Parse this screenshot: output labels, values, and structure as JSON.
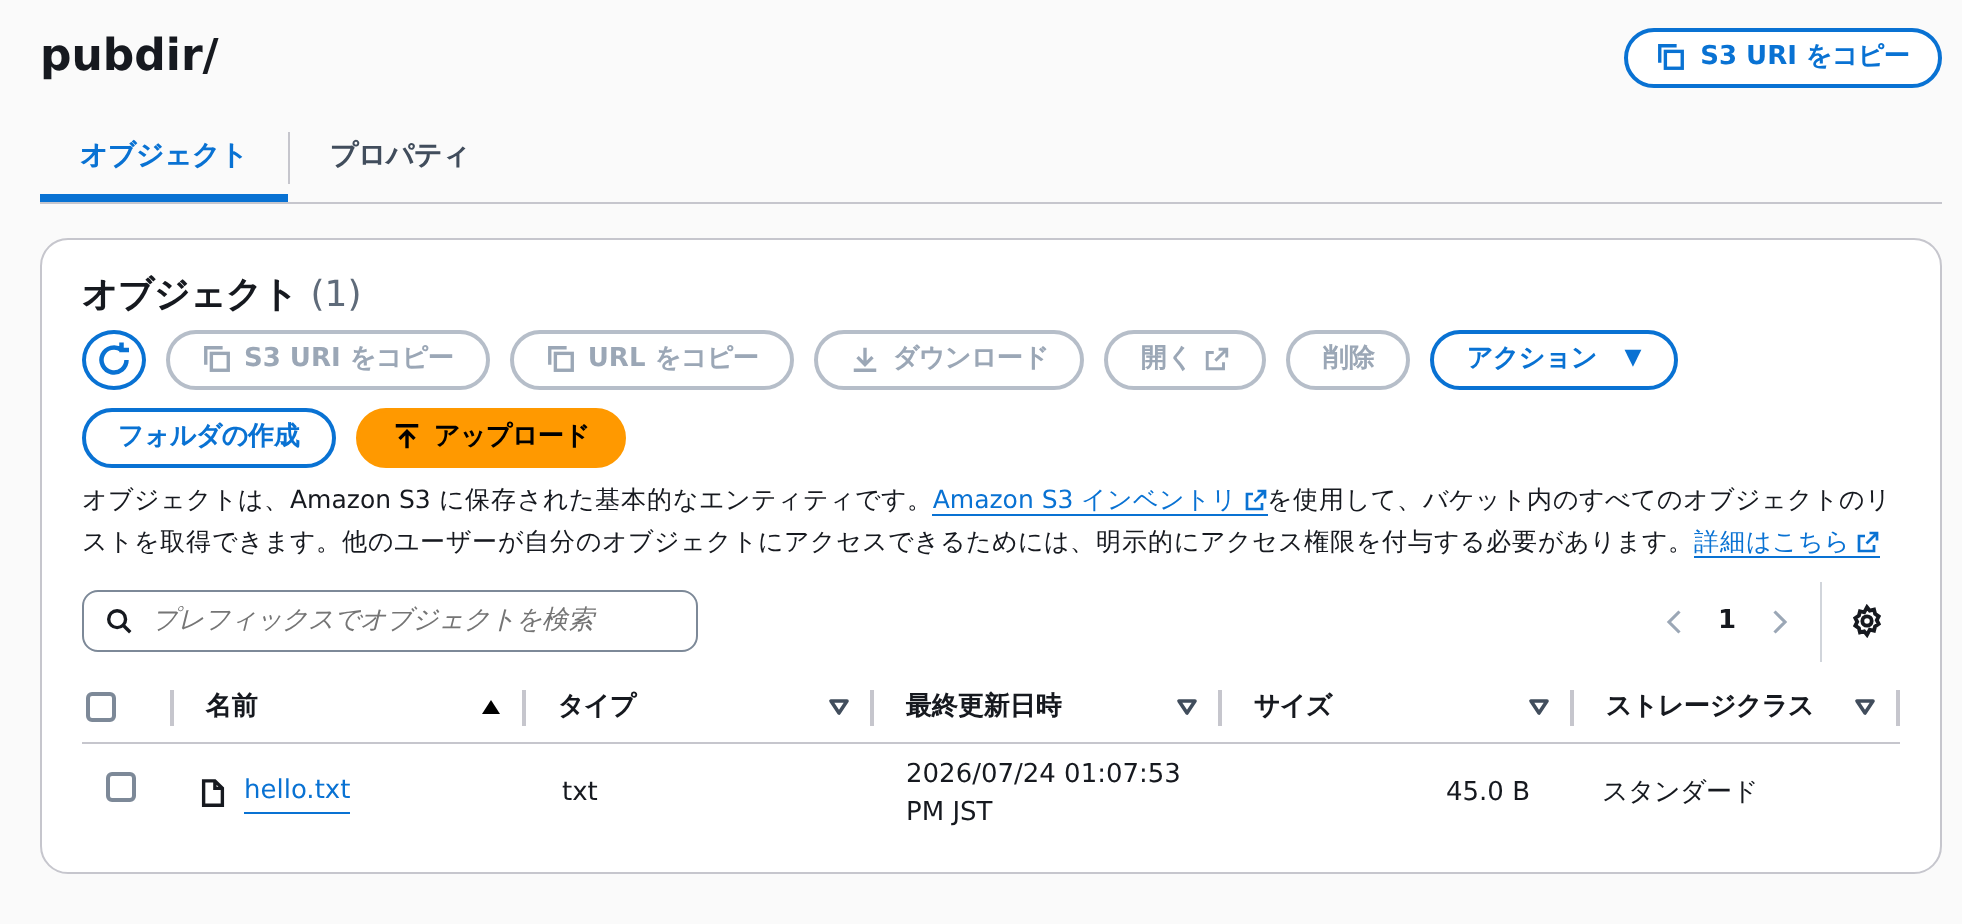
{
  "header": {
    "title": "pubdir/",
    "copy_button": "S3 URI をコピー"
  },
  "tabs": [
    {
      "label": "オブジェクト",
      "selected": true
    },
    {
      "label": "プロパティ",
      "selected": false
    }
  ],
  "panel": {
    "title": "オブジェクト",
    "count": "(1)",
    "toolbar": [
      {
        "kind": "refresh",
        "disabled": false
      },
      {
        "kind": "copy",
        "label": "S3 URI をコピー",
        "disabled": true
      },
      {
        "kind": "copy",
        "label": "URL をコピー",
        "disabled": true
      },
      {
        "kind": "download",
        "label": "ダウンロード",
        "disabled": true
      },
      {
        "kind": "open",
        "label": "開く",
        "disabled": true
      },
      {
        "kind": "plain",
        "label": "削除",
        "disabled": true
      },
      {
        "kind": "dropdown",
        "label": "アクション",
        "caret": "▼",
        "disabled": false
      },
      {
        "kind": "plain",
        "label": "フォルダの作成",
        "disabled": false
      },
      {
        "kind": "upload",
        "label": "アップロード",
        "disabled": false
      }
    ],
    "description": [
      {
        "kind": "text",
        "text": "オブジェクトは、Amazon S3 に保存された基本的なエンティティです。"
      },
      {
        "kind": "link",
        "text": "Amazon S3 インベントリ"
      },
      {
        "kind": "text",
        "text": "を使用して、バケット内のすべてのオブジェクトのリストを取得できます。他のユーザーが自分のオブジェクトにアクセスできるためには、明示的にアクセス権限を付与する必要があります。"
      },
      {
        "kind": "link",
        "text": "詳細はこちら"
      }
    ],
    "search": {
      "placeholder": "プレフィックスでオブジェクトを検索"
    },
    "pagination": {
      "page": "1"
    },
    "table": {
      "select_all_checked": false,
      "columns": [
        {
          "label": "名前",
          "sorted": true
        },
        {
          "label": "タイプ",
          "sorted": false
        },
        {
          "label": "最終更新日時",
          "sorted": false
        },
        {
          "label": "サイズ",
          "sorted": false
        },
        {
          "label": "ストレージクラス",
          "sorted": false
        }
      ],
      "rows": [
        {
          "checked": false,
          "name": "hello.txt",
          "type": "txt",
          "modified": "2026/07/24 01:07:53 PM JST",
          "size": "45.0 B",
          "storage_class": "スタンダード"
        }
      ]
    }
  }
}
